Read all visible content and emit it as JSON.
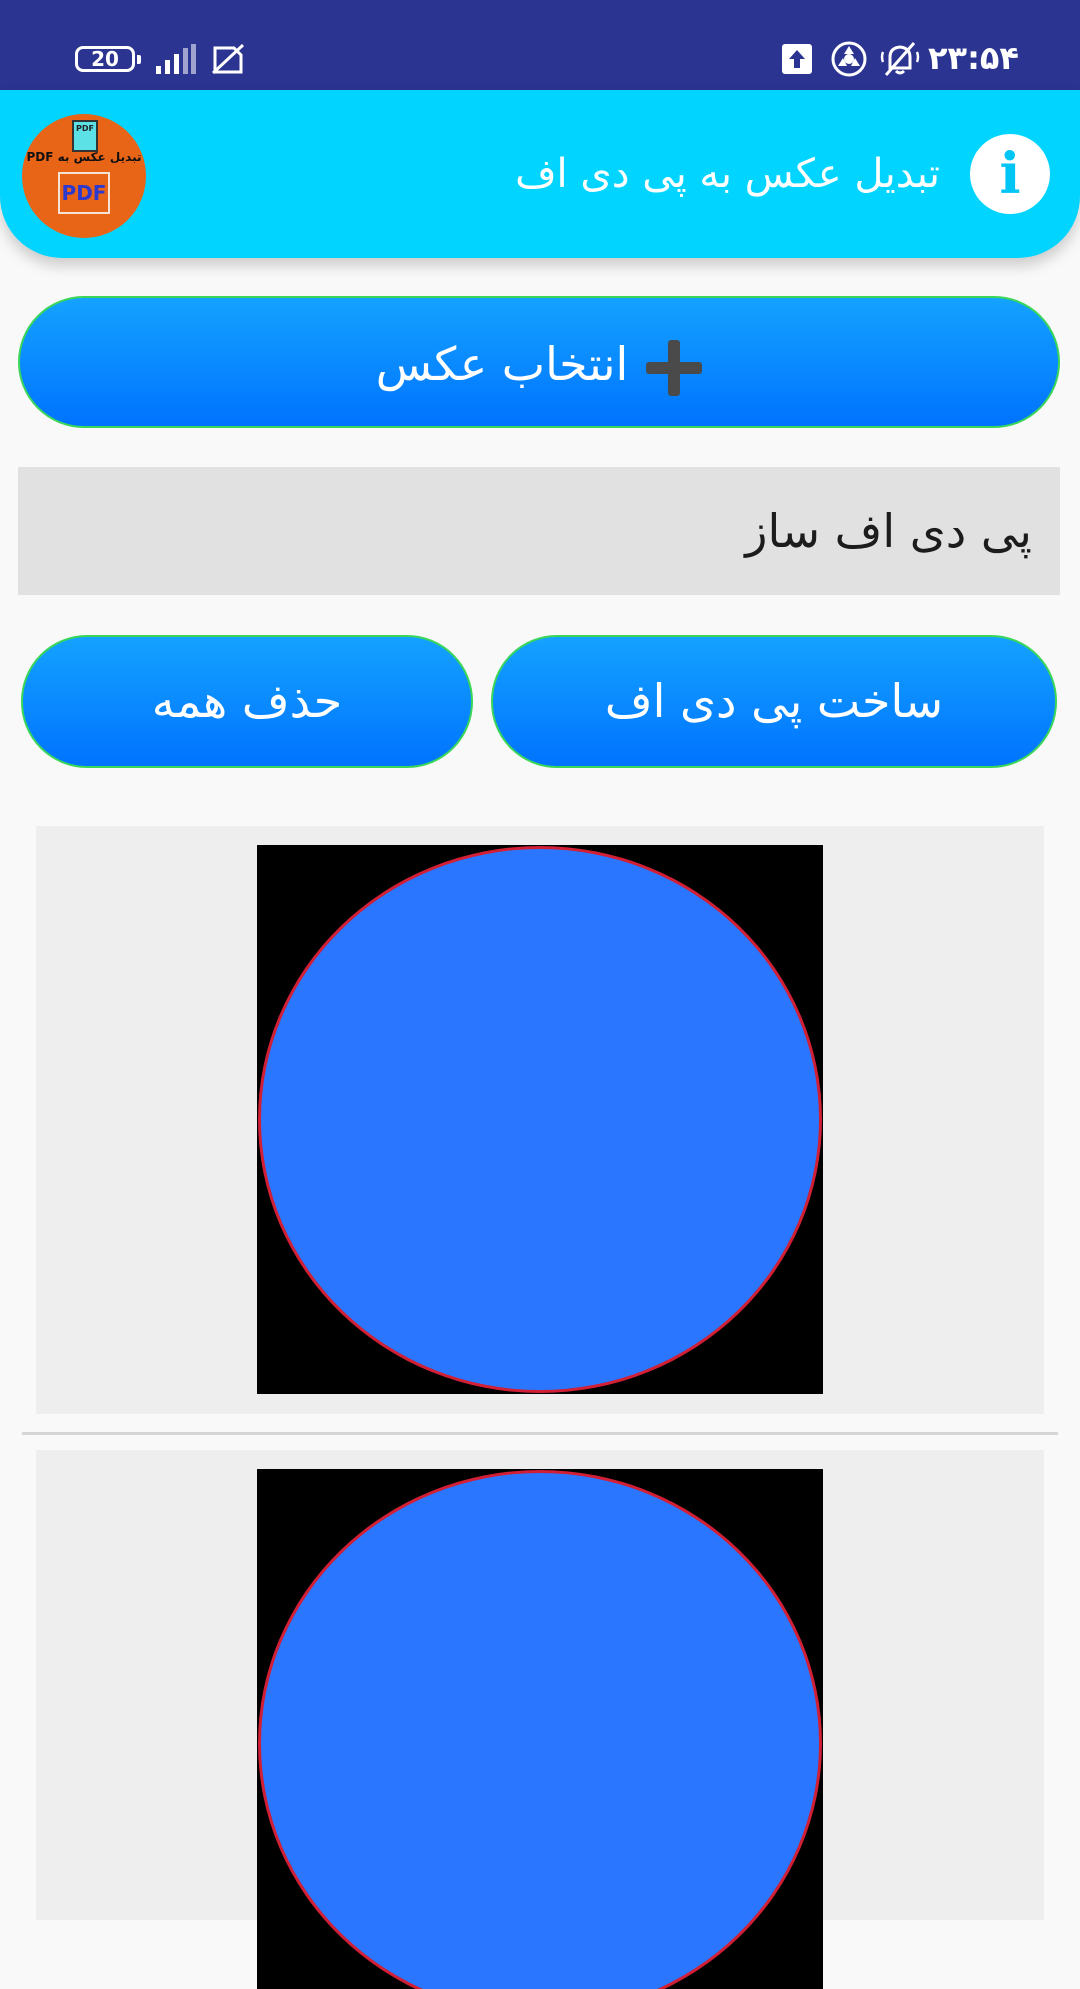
{
  "status_bar": {
    "battery_level": "20",
    "time": "۲۳:۵۴",
    "icons": [
      "battery-icon",
      "signal-icon",
      "no-sim-icon",
      "upload-icon",
      "vpn-icon",
      "silent-mode-icon"
    ]
  },
  "app_bar": {
    "title": "تبدیل عکس به پی دی اف",
    "logo": {
      "doc_text": "PDF",
      "caption": "تبدیل عکس به PDF",
      "badge_text": "PDF"
    },
    "info_glyph": "i"
  },
  "actions": {
    "select_image_label": "انتخاب عکس",
    "filename_value": "پی دی اف ساز",
    "make_pdf_label": "ساخت پی دی اف",
    "delete_all_label": "حذف همه"
  },
  "colors": {
    "status_bar": "#2b3490",
    "app_bar": "#00d4ff",
    "button_gradient_top": "#14a2ff",
    "button_gradient_bottom": "#0073ff",
    "button_border": "#39d65a",
    "image_circle_fill": "#2a76ff",
    "image_circle_stroke": "#d11f35"
  }
}
